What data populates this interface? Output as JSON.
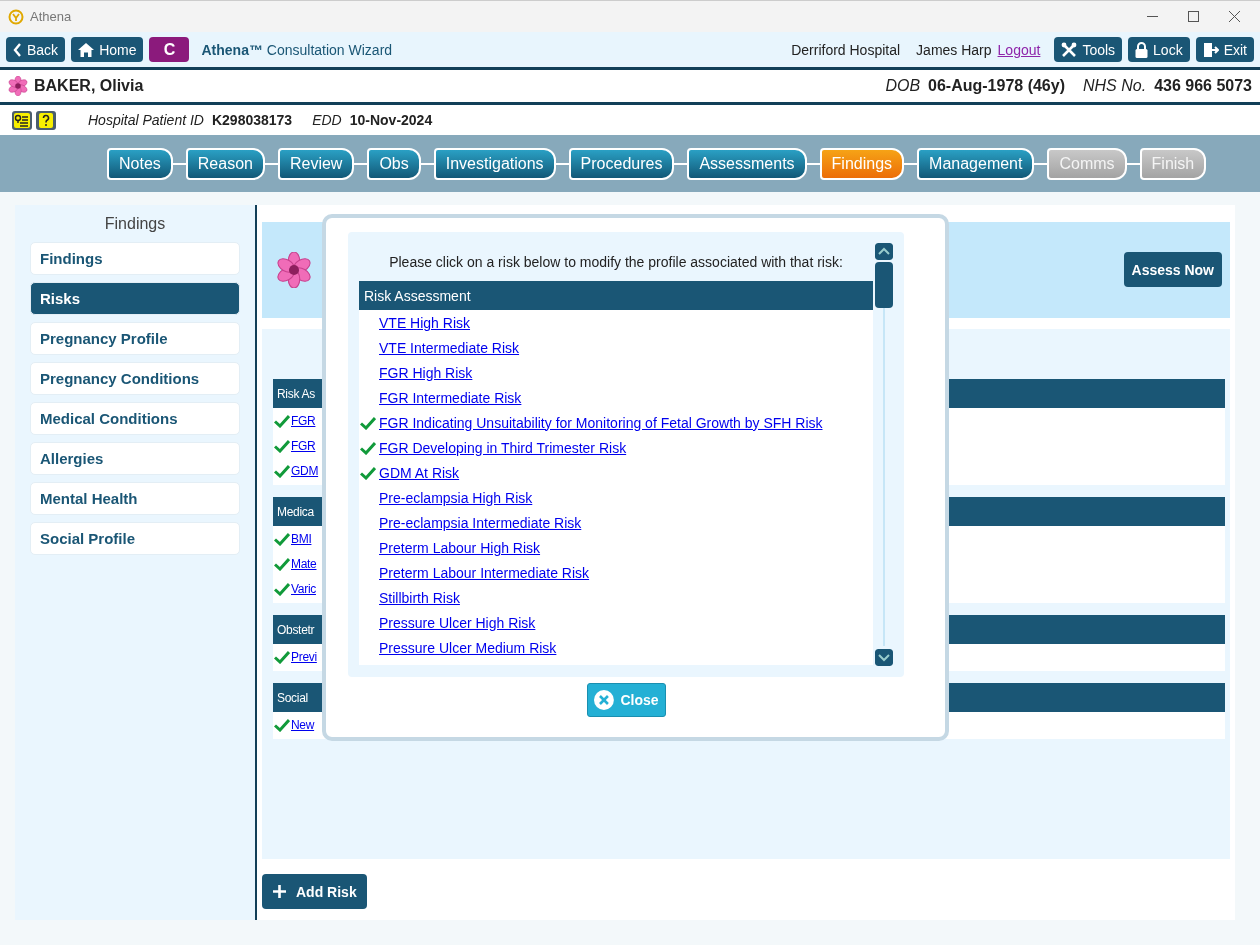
{
  "window": {
    "title": "Athena"
  },
  "toolbar": {
    "nav_buttons": [
      {
        "label": "Back",
        "kind": "back"
      },
      {
        "label": "Home",
        "kind": "home"
      },
      {
        "label": "C",
        "kind": "badge"
      }
    ],
    "app_title": "**Athena™** Consultation Wizard",
    "hospital": "Derriford Hospital",
    "user": "James Harp",
    "logout": "Logout",
    "action_buttons": [
      {
        "label": "Tools",
        "kind": "tools"
      },
      {
        "label": "Lock",
        "kind": "lock"
      },
      {
        "label": "Exit",
        "kind": "exit"
      }
    ]
  },
  "patient": {
    "name": "BAKER, Olivia",
    "dob_label": "DOB",
    "dob": "06-Aug-1978 (46y)",
    "nhs_label": "NHS No.",
    "nhs": "436 966 5073"
  },
  "ids": {
    "hospital_id_label": "Hospital Patient ID",
    "hospital_id": "K298038173",
    "edd_label": "EDD",
    "edd": "10-Nov-2024"
  },
  "steps": [
    {
      "label": "Notes",
      "selected": false,
      "disabled": false
    },
    {
      "label": "Reason",
      "selected": false,
      "disabled": false
    },
    {
      "label": "Review",
      "selected": false,
      "disabled": false
    },
    {
      "label": "Obs",
      "selected": false,
      "disabled": false
    },
    {
      "label": "Investigations",
      "selected": false,
      "disabled": false
    },
    {
      "label": "Procedures",
      "selected": false,
      "disabled": false
    },
    {
      "label": "Assessments",
      "selected": false,
      "disabled": false
    },
    {
      "label": "Findings",
      "selected": true,
      "disabled": false
    },
    {
      "label": "Management",
      "selected": false,
      "disabled": false
    },
    {
      "label": "Comms",
      "selected": false,
      "disabled": true
    },
    {
      "label": "Finish",
      "selected": false,
      "disabled": true
    }
  ],
  "sidebar": {
    "title": "Findings",
    "items": [
      {
        "label": "Findings",
        "selected": false
      },
      {
        "label": "Risks",
        "selected": true
      },
      {
        "label": "Pregnancy Profile",
        "selected": false
      },
      {
        "label": "Pregnancy Conditions",
        "selected": false
      },
      {
        "label": "Medical Conditions",
        "selected": false
      },
      {
        "label": "Allergies",
        "selected": false
      },
      {
        "label": "Mental Health",
        "selected": false
      },
      {
        "label": "Social Profile",
        "selected": false
      }
    ]
  },
  "banner": {
    "button": "Assess Now"
  },
  "sections": [
    {
      "title": "Risk As",
      "items": [
        {
          "label": "FGR",
          "checked": true
        },
        {
          "label": "FGR",
          "checked": true
        },
        {
          "label": "GDM",
          "checked": true
        }
      ]
    },
    {
      "title": "Medica",
      "items": [
        {
          "label": "BMI",
          "checked": true
        },
        {
          "label": "Mate",
          "checked": true
        },
        {
          "label": "Varic",
          "checked": true
        }
      ]
    },
    {
      "title": "Obstetr",
      "items": [
        {
          "label": "Previ",
          "checked": true
        }
      ]
    },
    {
      "title": "Social",
      "items": [
        {
          "label": "New",
          "checked": true
        }
      ]
    }
  ],
  "add_button": "Add Risk",
  "modal": {
    "instruction": "Please click on a risk below to modify the profile associated with that risk:",
    "list_title": "Risk Assessment",
    "items": [
      {
        "label": "VTE High Risk",
        "checked": false
      },
      {
        "label": "VTE Intermediate Risk",
        "checked": false
      },
      {
        "label": "FGR High Risk",
        "checked": false
      },
      {
        "label": "FGR Intermediate Risk",
        "checked": false
      },
      {
        "label": "FGR Indicating Unsuitability for Monitoring of Fetal Growth by SFH Risk",
        "checked": true
      },
      {
        "label": "FGR Developing in Third Trimester Risk",
        "checked": true
      },
      {
        "label": "GDM At Risk",
        "checked": true
      },
      {
        "label": "Pre-eclampsia High Risk",
        "checked": false
      },
      {
        "label": "Pre-eclampsia Intermediate Risk",
        "checked": false
      },
      {
        "label": "Preterm Labour High Risk",
        "checked": false
      },
      {
        "label": "Preterm Labour Intermediate Risk",
        "checked": false
      },
      {
        "label": "Stillbirth Risk",
        "checked": false
      },
      {
        "label": "Pressure Ulcer High Risk",
        "checked": false
      },
      {
        "label": "Pressure Ulcer Medium Risk",
        "checked": false
      }
    ],
    "close": "Close"
  }
}
